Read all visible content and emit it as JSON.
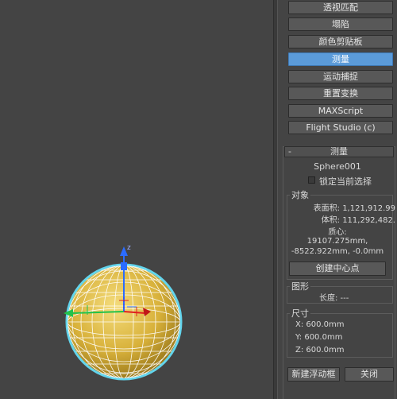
{
  "utilities": {
    "buttons": [
      {
        "label": "透视匹配",
        "active": false
      },
      {
        "label": "塌陷",
        "active": false
      },
      {
        "label": "颜色剪贴板",
        "active": false
      },
      {
        "label": "测量",
        "active": true
      },
      {
        "label": "运动捕捉",
        "active": false
      },
      {
        "label": "重置变换",
        "active": false
      },
      {
        "label": "MAXScript",
        "active": false
      },
      {
        "label": "Flight Studio (c)",
        "active": false
      }
    ]
  },
  "measure": {
    "rollout_toggle": "-",
    "rollout_title": "测量",
    "object_name": "Sphere001",
    "lock_label": "锁定当前选择",
    "object_group": {
      "label": "对象",
      "surface_area": "表面积: 1,121,912.99",
      "volume": "体积: 111,292,482.",
      "center_label": "质心:",
      "center_line1": "19107.275mm,",
      "center_line2": "-8522.922mm, -0.0mm",
      "create_center_button": "创建中心点"
    },
    "shape_group": {
      "label": "图形",
      "length": "长度: ---"
    },
    "dimensions_group": {
      "label": "尺寸",
      "x": "X:  600.0mm",
      "y": "Y:  600.0mm",
      "z": "Z:  600.0mm"
    },
    "new_floater_button": "新建浮动框",
    "close_button": "关闭"
  },
  "viewport": {
    "object": "sphere",
    "object_color": "#d8b13a",
    "gizmo_axes": [
      "x",
      "y",
      "z"
    ],
    "gizmo_z_label": "z"
  }
}
